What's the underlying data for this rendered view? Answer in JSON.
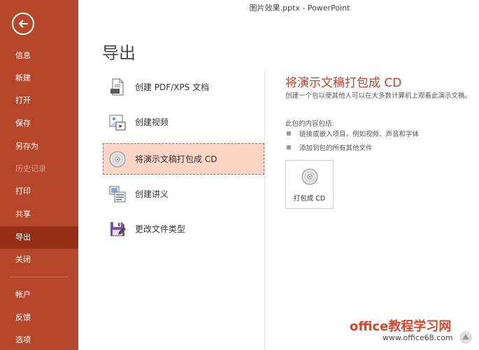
{
  "window": {
    "title": "图片效果.pptx  -  PowerPoint"
  },
  "sidebar": {
    "back_icon": "back-arrow-icon",
    "items": [
      {
        "label": "信息",
        "state": "normal"
      },
      {
        "label": "新建",
        "state": "normal"
      },
      {
        "label": "打开",
        "state": "normal"
      },
      {
        "label": "保存",
        "state": "normal"
      },
      {
        "label": "另存为",
        "state": "normal"
      },
      {
        "label": "历史记录",
        "state": "disabled"
      },
      {
        "label": "打印",
        "state": "normal"
      },
      {
        "label": "共享",
        "state": "normal"
      },
      {
        "label": "导出",
        "state": "active"
      },
      {
        "label": "关闭",
        "state": "normal"
      },
      {
        "label": "帐户",
        "state": "normal"
      },
      {
        "label": "反馈",
        "state": "normal"
      },
      {
        "label": "选项",
        "state": "normal"
      }
    ]
  },
  "main": {
    "title": "导出",
    "options": [
      {
        "label": "创建 PDF/XPS 文档",
        "icon": "pdf-document-icon",
        "selected": false
      },
      {
        "label": "创建视频",
        "icon": "video-icon",
        "selected": false
      },
      {
        "label": "将演示文稿打包成 CD",
        "icon": "cd-icon",
        "selected": true
      },
      {
        "label": "创建讲义",
        "icon": "handout-icon",
        "selected": false
      },
      {
        "label": "更改文件类型",
        "icon": "change-file-type-icon",
        "selected": false
      }
    ]
  },
  "panel": {
    "title": "将演示文稿打包成 CD",
    "description": "创建一个包以便其他人可以在大多数计算机上观看此演示文稿。",
    "contents_heading": "此包的内容包括:",
    "bullets": [
      "链接或嵌入项目，例如视频、声音和字体",
      "添加到包的所有其他文件"
    ],
    "package_button": {
      "label": "打包成 CD",
      "icon": "cd-icon"
    }
  },
  "watermark": {
    "line1": "office教程学习网",
    "line2": "www.office68.com"
  },
  "colors": {
    "sidebar": "#b7472a",
    "sidebar_active": "#962e15",
    "accent_title": "#c0432a",
    "selected_option": "#fcd5c4"
  }
}
